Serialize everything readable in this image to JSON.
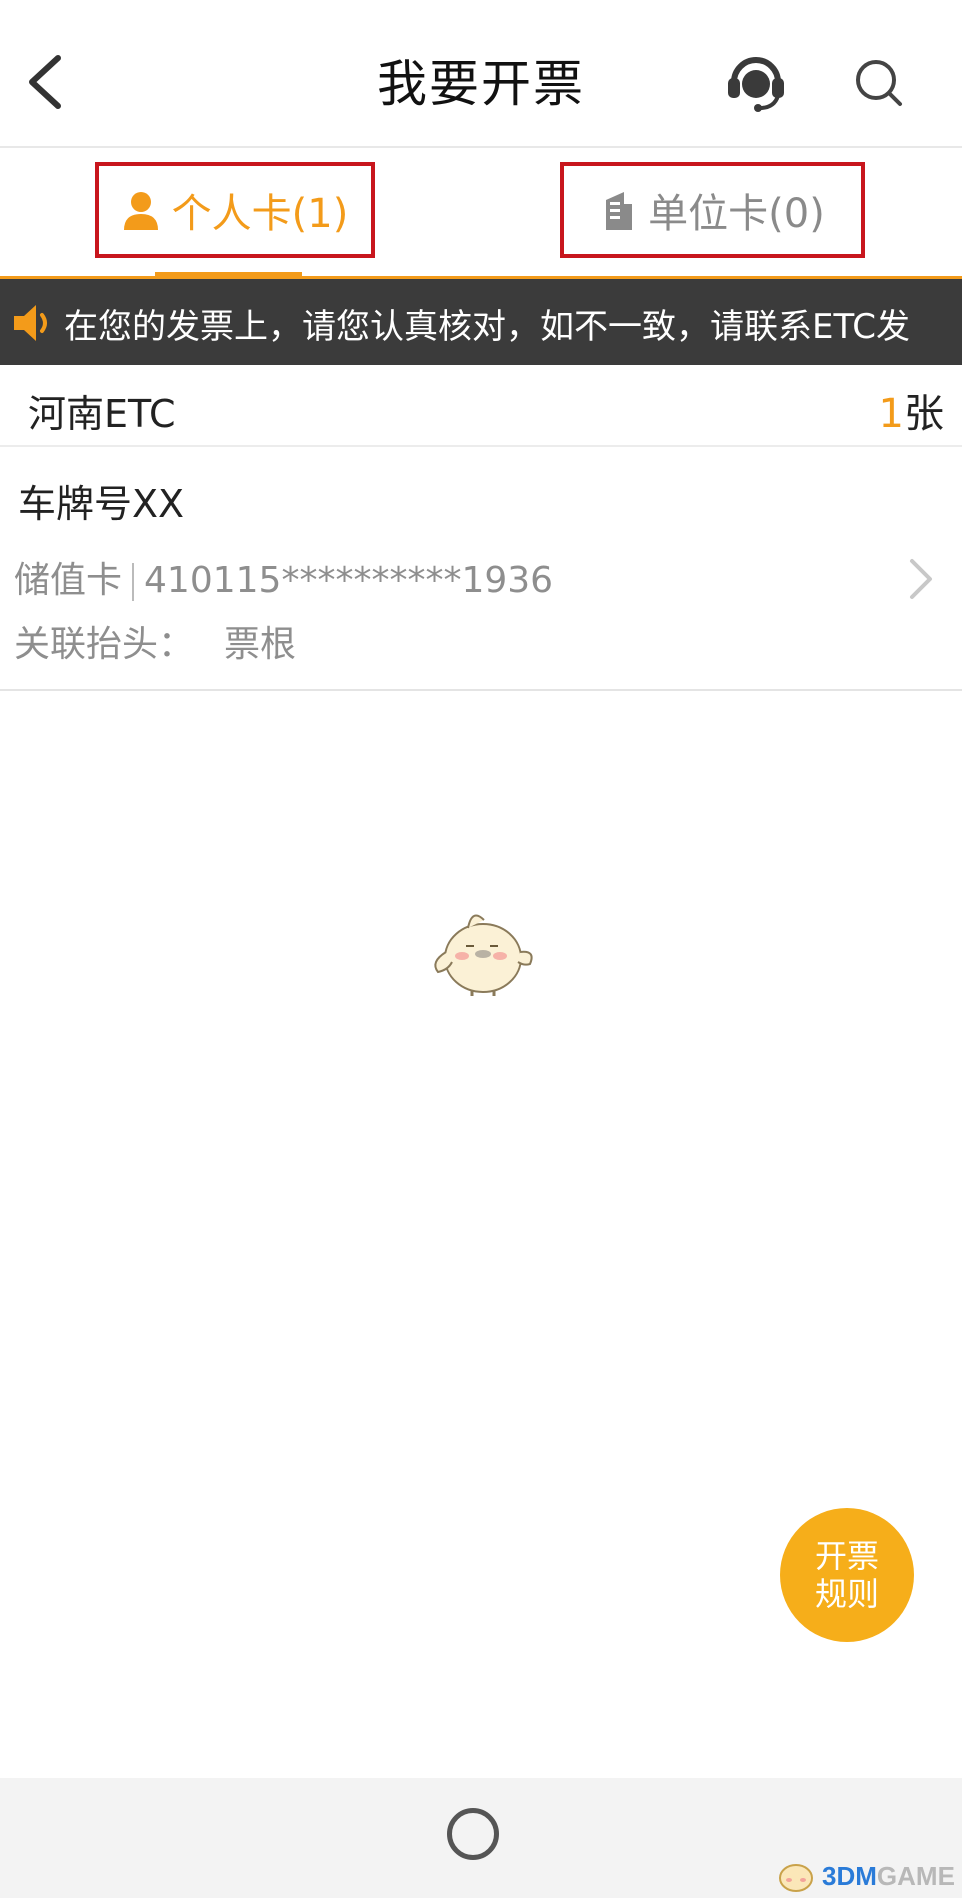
{
  "header": {
    "title": "我要开票"
  },
  "tabs": [
    {
      "label": "个人卡(1)"
    },
    {
      "label": "单位卡(0)"
    }
  ],
  "notice": {
    "text": "在您的发票上，请您认真核对，如不一致，请联系ETC发"
  },
  "group": {
    "name": "河南ETC",
    "count_num": "1",
    "count_unit": "张"
  },
  "card": {
    "plate": "车牌号XX",
    "type": "储值卡",
    "number": "410115**********1936",
    "linked_label": "关联抬头：",
    "linked_value": "票根"
  },
  "rules_button": {
    "line1": "开票",
    "line2": "规则"
  },
  "watermark": {
    "num": "3DM",
    "rest": "GAME"
  },
  "colors": {
    "accent": "#f39b1a",
    "highlight_box": "#c8161d",
    "notice_bg": "#3b3b3b",
    "rules_bg": "#f6ae1a"
  }
}
